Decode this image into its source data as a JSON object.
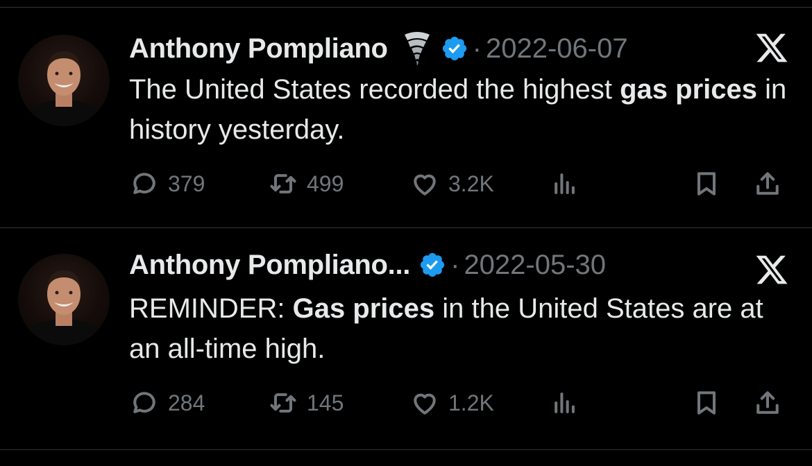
{
  "colors": {
    "background": "#000000",
    "text": "#e7e9ea",
    "muted": "#71767b",
    "verified": "#1d9bf0",
    "divider": "#2f3336"
  },
  "tweets": [
    {
      "display_name": "Anthony Pompliano",
      "name_emoji": "tornado-icon",
      "dot": "·",
      "date": "2022-06-07",
      "text_parts": {
        "pre": "The United States recorded the highest ",
        "bold": "gas prices",
        "post": " in history yesterday."
      },
      "counts": {
        "replies": "379",
        "retweets": "499",
        "likes": "3.2K"
      }
    },
    {
      "display_name": "Anthony Pompliano...",
      "dot": "·",
      "date": "2022-05-30",
      "text_parts": {
        "pre": "REMINDER: ",
        "bold": "Gas prices",
        "post": " in the United States are at an all-time high."
      },
      "counts": {
        "replies": "284",
        "retweets": "145",
        "likes": "1.2K"
      }
    }
  ],
  "icons": [
    "reply-icon",
    "retweet-icon",
    "like-icon",
    "views-icon",
    "bookmark-icon",
    "share-icon",
    "x-logo-icon",
    "verified-badge-icon"
  ]
}
